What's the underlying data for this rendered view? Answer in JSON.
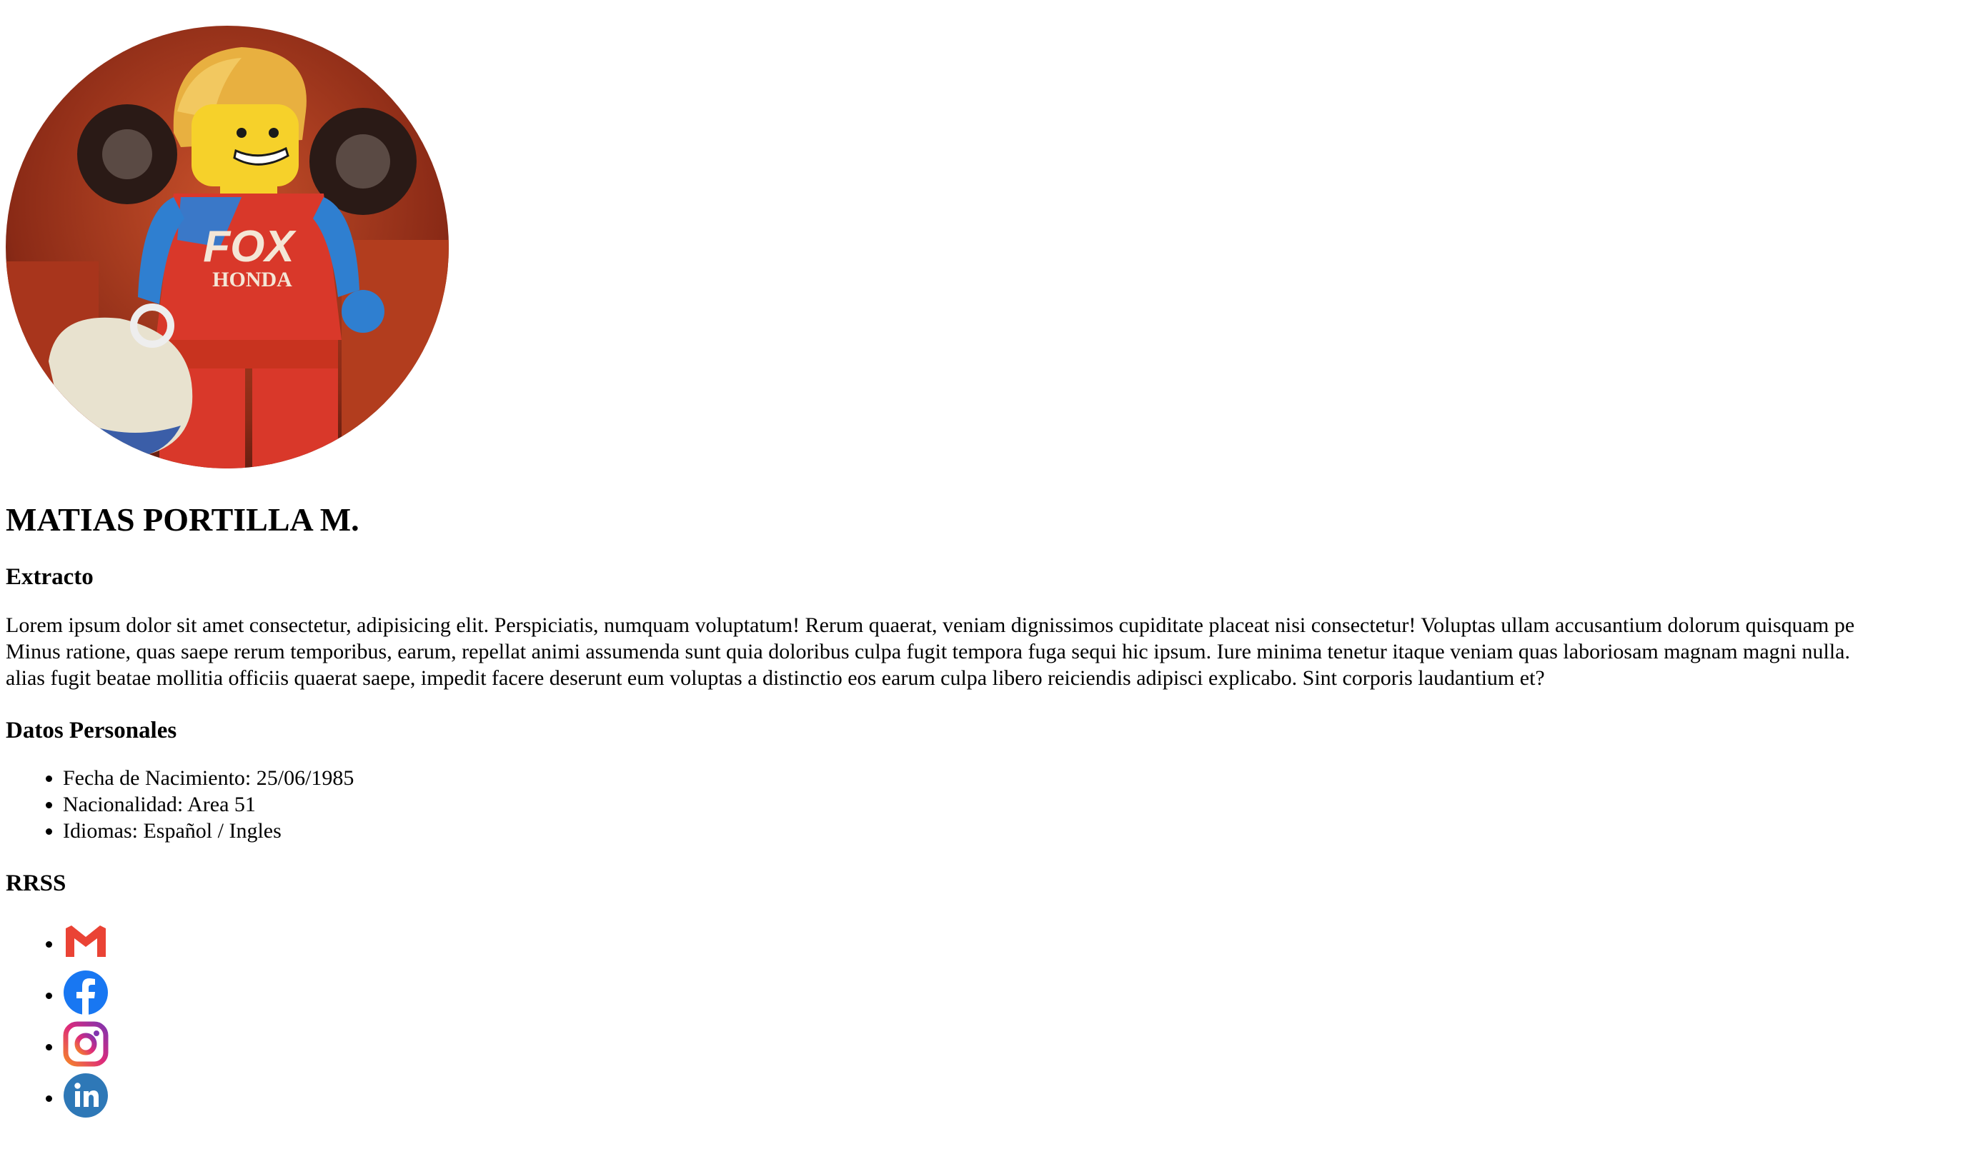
{
  "profile": {
    "image_alt": "avatar",
    "name": "MATIAS PORTILLA M."
  },
  "extract": {
    "heading": "Extracto",
    "lines": [
      "Lorem ipsum dolor sit amet consectetur, adipisicing elit. Perspiciatis, numquam voluptatum! Rerum quaerat, veniam dignissimos cupiditate placeat nisi consectetur! Voluptas ullam accusantium dolorum quisquam pe",
      "Minus ratione, quas saepe rerum temporibus, earum, repellat animi assumenda sunt quia doloribus culpa fugit tempora fuga sequi hic ipsum. Iure minima tenetur itaque veniam quas laboriosam magnam magni nulla.",
      "alias fugit beatae mollitia officiis quaerat saepe, impedit facere deserunt eum voluptas a distinctio eos earum culpa libero reiciendis adipisci explicabo. Sint corporis laudantium et?"
    ]
  },
  "personal": {
    "heading": "Datos Personales",
    "items": [
      "Fecha de Nacimiento: 25/06/1985",
      "Nacionalidad: Area 51",
      "Idiomas: Español / Ingles"
    ]
  },
  "social": {
    "heading": "RRSS",
    "icons": [
      "gmail-icon",
      "facebook-icon",
      "instagram-icon",
      "linkedin-icon"
    ]
  },
  "colors": {
    "gmail_red": "#EA4335",
    "facebook_blue": "#1877F2",
    "instagram_purple": "#C13584",
    "linkedin_blue": "#2E78B7"
  }
}
